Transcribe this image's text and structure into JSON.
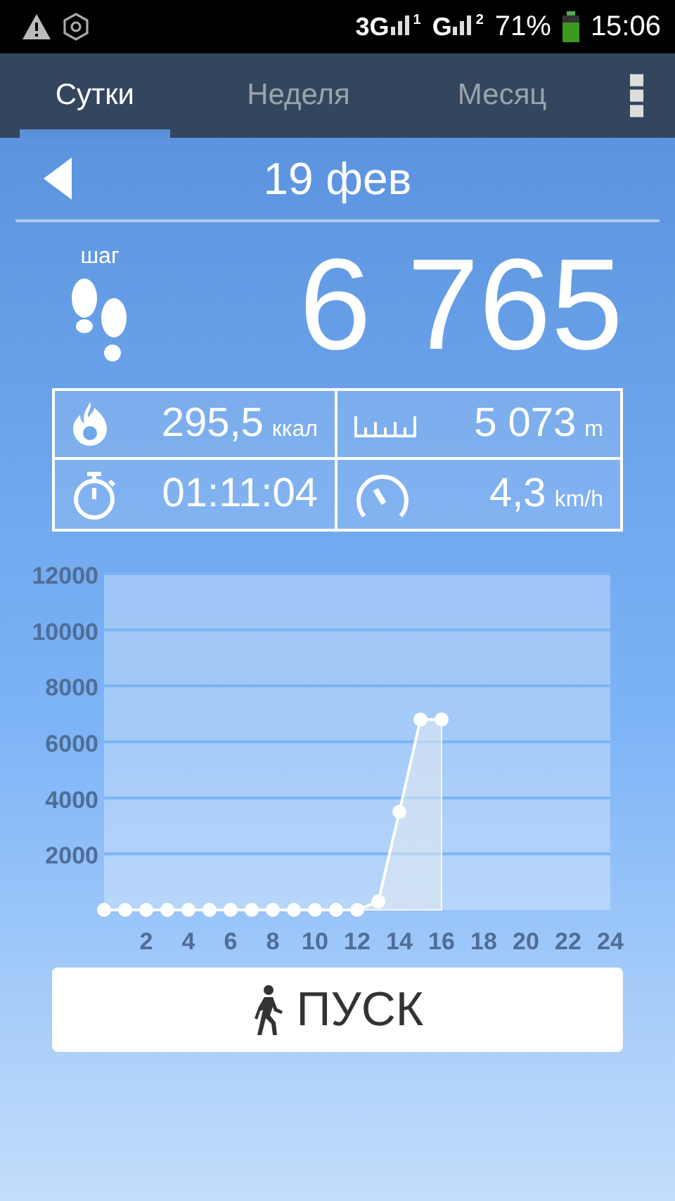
{
  "status_bar": {
    "network_1": "3G",
    "sim_1": "1",
    "network_2": "G",
    "sim_2": "2",
    "battery": "71%",
    "time": "15:06"
  },
  "tabs": [
    {
      "label": "Сутки",
      "selected": true
    },
    {
      "label": "Неделя",
      "selected": false
    },
    {
      "label": "Месяц",
      "selected": false
    }
  ],
  "date": "19 фев",
  "steps": {
    "label": "шаг",
    "value": "6 765"
  },
  "stats": [
    {
      "kind": "calories",
      "value": "295,5",
      "unit": "ккал"
    },
    {
      "kind": "distance",
      "value": "5 073",
      "unit": "m"
    },
    {
      "kind": "time",
      "value": "01:11:04"
    },
    {
      "kind": "speed",
      "value": "4,3",
      "unit": "km/h"
    }
  ],
  "chart": {
    "chart_data": {
      "type": "line",
      "grid": true,
      "x": [
        0,
        1,
        2,
        3,
        4,
        5,
        6,
        7,
        8,
        9,
        10,
        11,
        12,
        13,
        14,
        15,
        16
      ],
      "series": [
        {
          "color": "#ffffff",
          "marker": "circle",
          "values": [
            0,
            0,
            0,
            0,
            0,
            0,
            0,
            0,
            0,
            0,
            0,
            0,
            0,
            300,
            3500,
            6800,
            6800
          ]
        }
      ],
      "xlim": [
        0,
        24
      ],
      "ylim": [
        0,
        12000
      ],
      "xticks": [
        2,
        4,
        6,
        8,
        10,
        12,
        14,
        16,
        18,
        20,
        22,
        24
      ],
      "yticks": [
        2000,
        4000,
        6000,
        8000,
        10000,
        12000
      ]
    }
  },
  "start_button": {
    "label": "ПУСК"
  }
}
